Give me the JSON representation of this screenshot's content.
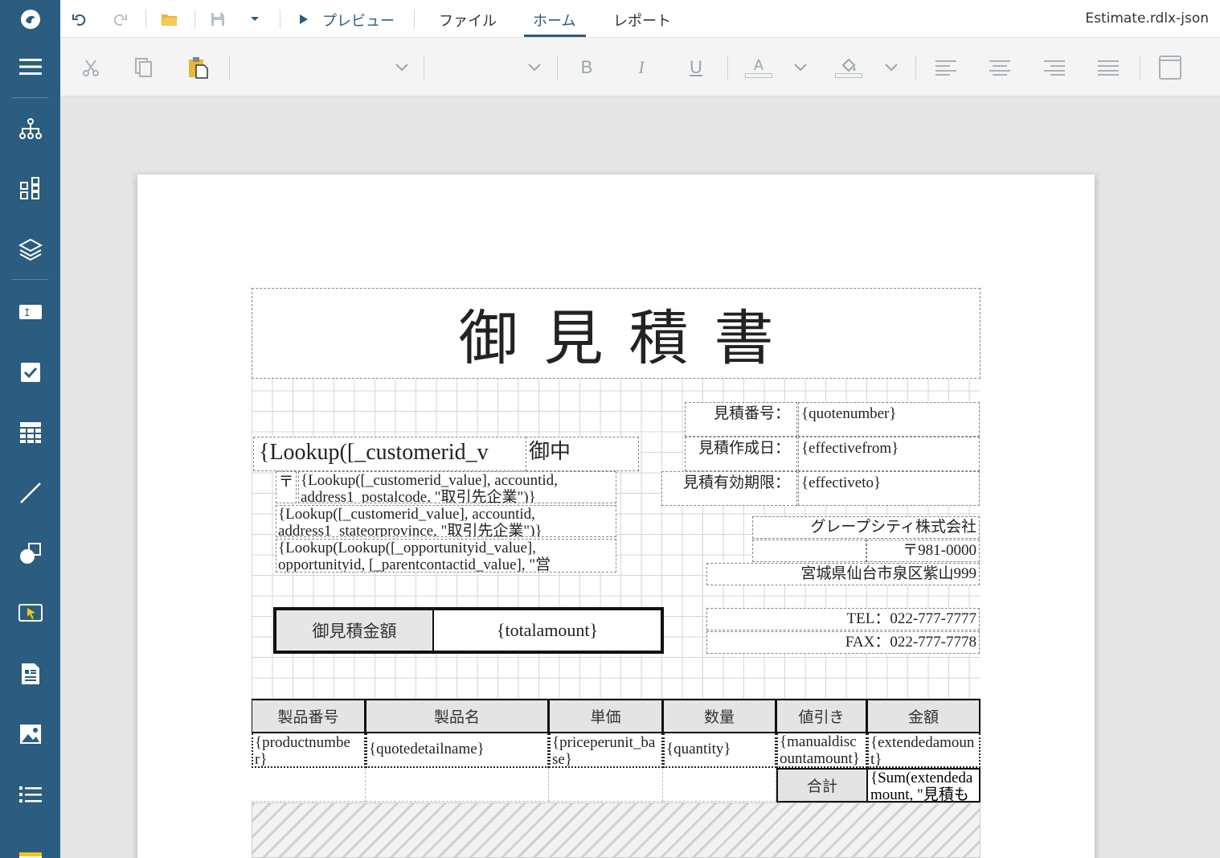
{
  "app": {
    "filename": "Estimate.rdlx-json",
    "colors": {
      "sidebar": "#2a5d7f",
      "accent": "#2a5d7f"
    }
  },
  "topbar": {
    "preview_label": "プレビュー",
    "tabs": [
      "ファイル",
      "ホーム",
      "レポート"
    ],
    "active_tab": "ホーム"
  },
  "ribbon": {
    "bold": "B",
    "italic": "I",
    "underline": "U",
    "font_color": "A"
  },
  "sidebar": {
    "items": [
      "logo-icon",
      "menu-icon",
      "hierarchy-icon",
      "components-icon",
      "layers-icon",
      "textbox-icon",
      "checkbox-icon",
      "table-icon",
      "line-icon",
      "shapes-icon",
      "select-icon",
      "report-part-icon",
      "image-icon",
      "list-icon",
      "tablix-icon"
    ]
  },
  "report": {
    "title": "御見積書",
    "customer_name": "{Lookup([_customerid_v",
    "honorific": "御中",
    "postal_mark": "〒",
    "postal_code_expr": "{Lookup([_customerid_value], accountid, address1_postalcode, \"取引先企業\")}",
    "state_expr": "{Lookup([_customerid_value], accountid, address1_stateorprovince, \"取引先企業\")}",
    "contact_expr": "{Lookup(Lookup([_opportunityid_value], opportunityid, [_parentcontactid_value], \"営",
    "quote_number_label": "見積番号：",
    "quote_number_value": "{quotenumber}",
    "created_label": "見積作成日：",
    "created_value": "{effectivefrom}",
    "expiry_label": "見積有効期限：",
    "expiry_value": "{effectiveto}",
    "company_name": "グレープシティ株式会社",
    "company_postal": "〒981-0000",
    "company_address": "宮城県仙台市泉区紫山999",
    "tel": "TEL：022-777-7777",
    "fax": "FAX：022-777-7778",
    "amount_label": "御見積金額",
    "amount_value": "{totalamount}",
    "table": {
      "headers": [
        "製品番号",
        "製品名",
        "単価",
        "数量",
        "値引き",
        "金額"
      ],
      "row": [
        "{productnumber}",
        "{quotedetailname}",
        "{priceperunit_base}",
        "{quantity}",
        "{manualdiscountamount}",
        "{extendedamount}"
      ],
      "sum_label": "合計",
      "sum_value": "{Sum(extendedamount, \"見積もり詳細\")}"
    }
  }
}
